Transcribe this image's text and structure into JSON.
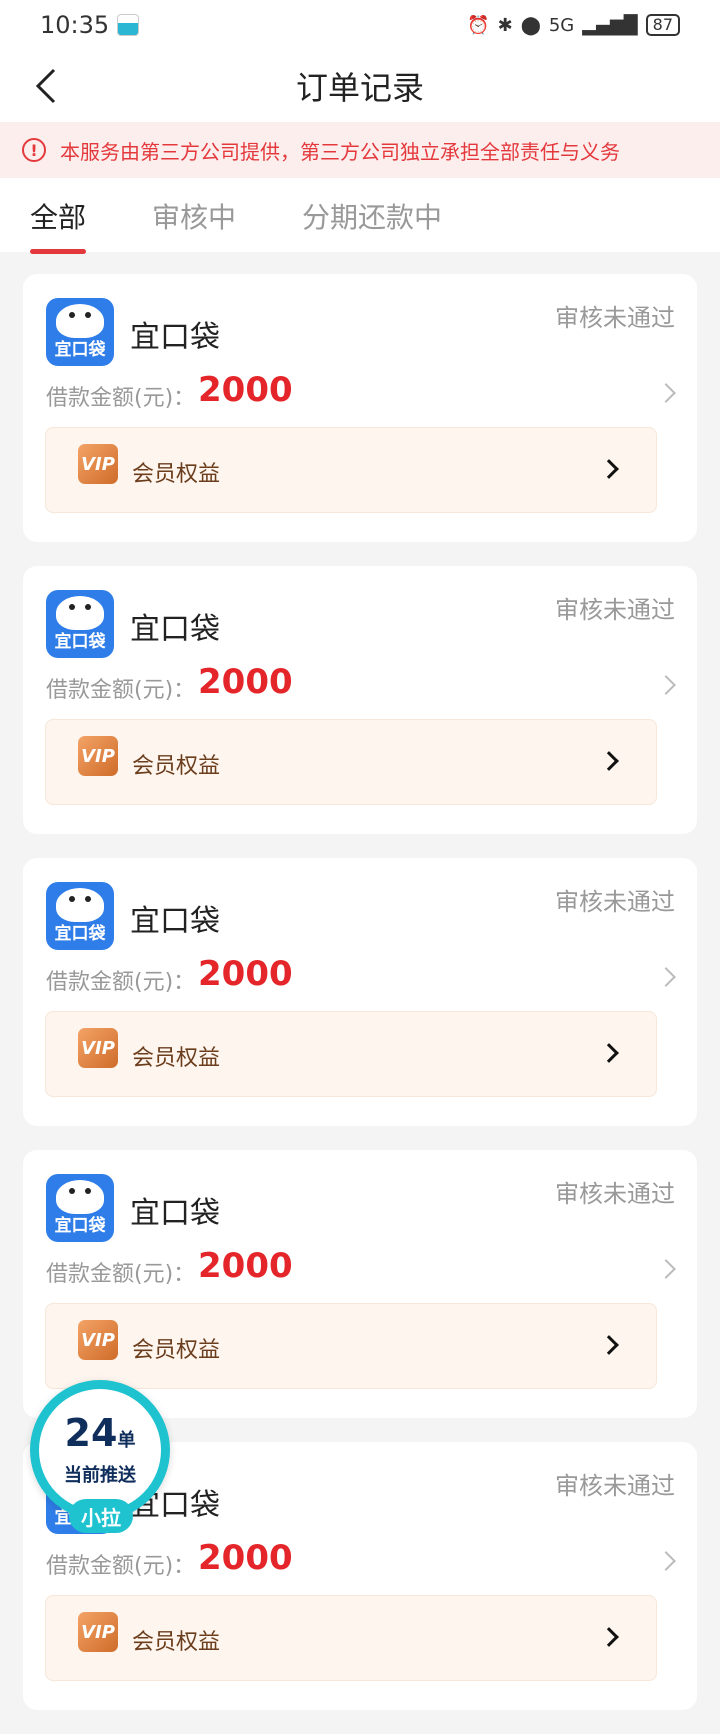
{
  "status_bar": {
    "time": "10:35",
    "battery": "87",
    "network": "5G"
  },
  "nav": {
    "title": "订单记录"
  },
  "notice": {
    "text": "本服务由第三方公司提供，第三方公司独立承担全部责任与义务"
  },
  "tabs": [
    {
      "label": "全部",
      "active": true
    },
    {
      "label": "审核中",
      "active": false
    },
    {
      "label": "分期还款中",
      "active": false
    }
  ],
  "orders": [
    {
      "logo_text": "宜口袋",
      "brand": "宜口袋",
      "status": "审核未通过",
      "amount_label": "借款金额(元)：",
      "amount": "2000",
      "vip_badge": "VIP",
      "vip_label": "会员权益"
    },
    {
      "logo_text": "宜口袋",
      "brand": "宜口袋",
      "status": "审核未通过",
      "amount_label": "借款金额(元)：",
      "amount": "2000",
      "vip_badge": "VIP",
      "vip_label": "会员权益"
    },
    {
      "logo_text": "宜口袋",
      "brand": "宜口袋",
      "status": "审核未通过",
      "amount_label": "借款金额(元)：",
      "amount": "2000",
      "vip_badge": "VIP",
      "vip_label": "会员权益"
    },
    {
      "logo_text": "宜口袋",
      "brand": "宜口袋",
      "status": "审核未通过",
      "amount_label": "借款金额(元)：",
      "amount": "2000",
      "vip_badge": "VIP",
      "vip_label": "会员权益"
    },
    {
      "logo_text": "宜口袋",
      "brand": "宜口袋",
      "status": "审核未通过",
      "amount_label": "借款金额(元)：",
      "amount": "2000",
      "vip_badge": "VIP",
      "vip_label": "会员权益"
    }
  ],
  "float_badge": {
    "count": "24",
    "unit": "单",
    "subtitle": "当前推送",
    "tag": "小拉"
  },
  "colors": {
    "accent": "#e4393c",
    "amount": "#e4262b",
    "badge": "#1ec3cf",
    "logo": "#2f7de8"
  }
}
